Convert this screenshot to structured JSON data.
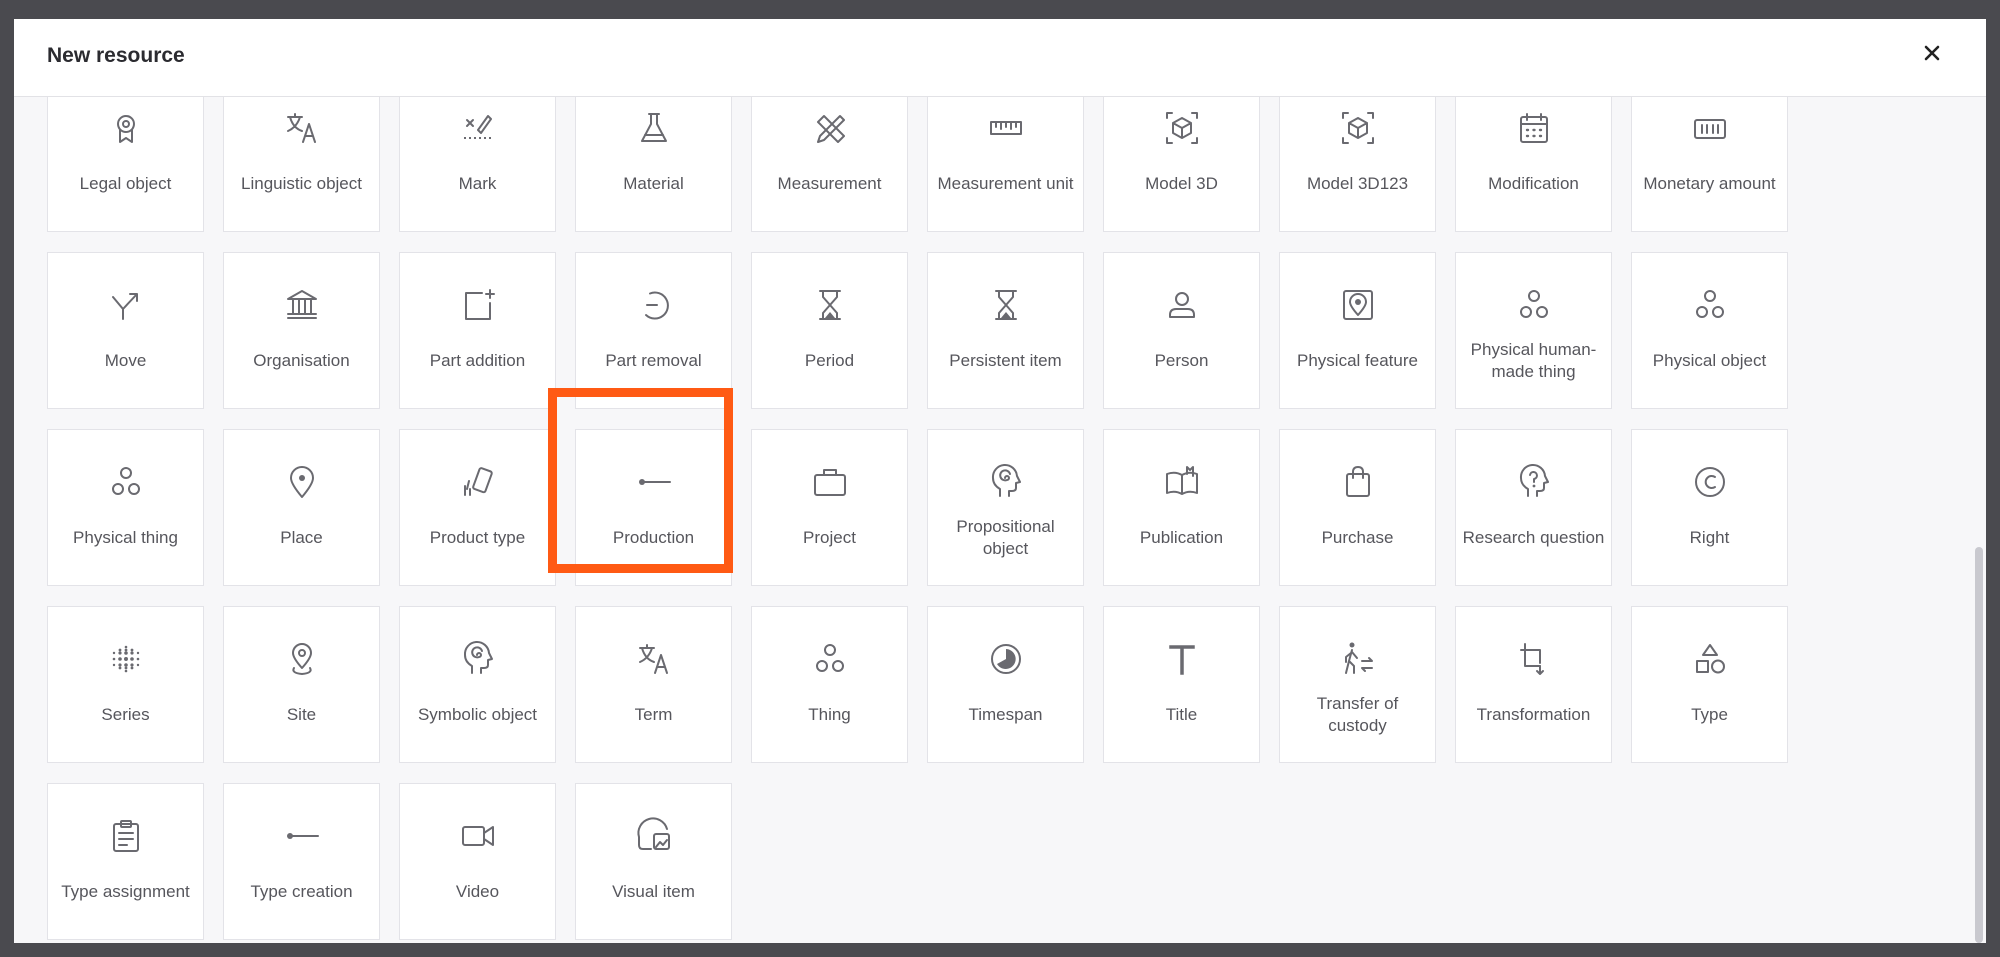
{
  "dialog": {
    "title": "New resource",
    "close_icon": "close-icon"
  },
  "highlight_color": "#ff5a14",
  "tiles": [
    {
      "label": "Legal object",
      "icon": "badge-icon"
    },
    {
      "label": "Linguistic object",
      "icon": "translate-icon"
    },
    {
      "label": "Mark",
      "icon": "mark-icon"
    },
    {
      "label": "Material",
      "icon": "flask-icon"
    },
    {
      "label": "Measurement",
      "icon": "ruler-pencil-icon"
    },
    {
      "label": "Measurement unit",
      "icon": "ruler-icon"
    },
    {
      "label": "Model 3D",
      "icon": "cube-icon"
    },
    {
      "label": "Model 3D123",
      "icon": "cube-icon"
    },
    {
      "label": "Modification",
      "icon": "calendar-icon"
    },
    {
      "label": "Monetary amount",
      "icon": "money-icon"
    },
    {
      "label": "Move",
      "icon": "move-icon"
    },
    {
      "label": "Organisation",
      "icon": "bank-icon"
    },
    {
      "label": "Part addition",
      "icon": "add-box-icon"
    },
    {
      "label": "Part removal",
      "icon": "remove-circle-icon"
    },
    {
      "label": "Period",
      "icon": "hourglass-icon"
    },
    {
      "label": "Persistent item",
      "icon": "hourglass-icon"
    },
    {
      "label": "Person",
      "icon": "person-icon"
    },
    {
      "label": "Physical feature",
      "icon": "map-pin-box-icon"
    },
    {
      "label": "Physical human-made thing",
      "icon": "circles-icon"
    },
    {
      "label": "Physical object",
      "icon": "circles-icon"
    },
    {
      "label": "Physical thing",
      "icon": "circles-icon"
    },
    {
      "label": "Place",
      "icon": "location-pin-icon"
    },
    {
      "label": "Product type",
      "icon": "product-tag-icon"
    },
    {
      "label": "Production",
      "icon": "line-dot-icon"
    },
    {
      "label": "Project",
      "icon": "briefcase-icon"
    },
    {
      "label": "Propositional object",
      "icon": "head-spiral-icon"
    },
    {
      "label": "Publication",
      "icon": "open-book-icon"
    },
    {
      "label": "Purchase",
      "icon": "shopping-bag-icon"
    },
    {
      "label": "Research question",
      "icon": "head-question-icon"
    },
    {
      "label": "Right",
      "icon": "copyright-icon"
    },
    {
      "label": "Series",
      "icon": "dot-grid-icon"
    },
    {
      "label": "Site",
      "icon": "site-pin-icon"
    },
    {
      "label": "Symbolic object",
      "icon": "head-spiral-icon"
    },
    {
      "label": "Term",
      "icon": "translate-icon"
    },
    {
      "label": "Thing",
      "icon": "circles-icon"
    },
    {
      "label": "Timespan",
      "icon": "timespan-icon"
    },
    {
      "label": "Title",
      "icon": "text-t-icon"
    },
    {
      "label": "Transfer of custody",
      "icon": "walk-transfer-icon"
    },
    {
      "label": "Transformation",
      "icon": "crop-icon"
    },
    {
      "label": "Type",
      "icon": "shapes-icon"
    },
    {
      "label": "Type assignment",
      "icon": "clipboard-icon"
    },
    {
      "label": "Type creation",
      "icon": "line-dot-icon"
    },
    {
      "label": "Video",
      "icon": "video-camera-icon"
    },
    {
      "label": "Visual item",
      "icon": "visual-item-icon"
    }
  ]
}
